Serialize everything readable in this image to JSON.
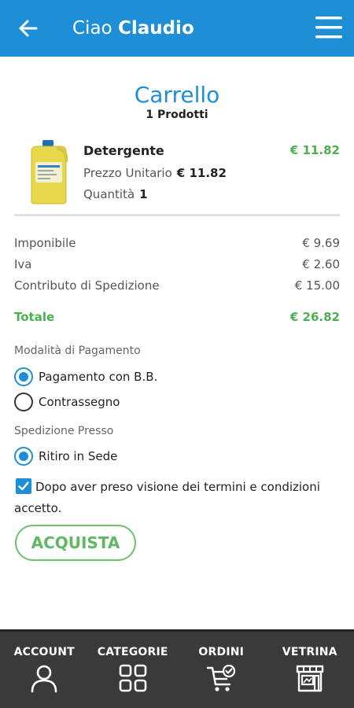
{
  "header": {
    "greeting": "Ciao",
    "user": "Claudio",
    "back_icon": "arrow-left-icon",
    "menu_icon": "hamburger-menu-icon",
    "color": "#1e8fd6"
  },
  "cart": {
    "title": "Carrello",
    "count": "1 Prodotti"
  },
  "product": {
    "name": "Detergente",
    "total": "€ 11.82",
    "unit_label": "Prezzo Unitario",
    "unit_price": "€ 11.82",
    "qty_label": "Quantità",
    "qty": "1"
  },
  "summary": {
    "imponibile_label": "Imponibile",
    "imponibile": "€ 9.69",
    "iva_label": "Iva",
    "iva": "€ 2.60",
    "spedizione_label": "Contributo di Spedizione",
    "spedizione": "€ 15.00",
    "totale_label": "Totale",
    "totale": "€ 26.82",
    "total_color": "#4caf50"
  },
  "payment": {
    "label": "Modalità di Pagamento",
    "options": [
      {
        "label": "Pagamento con B.B.",
        "selected": true
      },
      {
        "label": "Contrassegno",
        "selected": false
      }
    ]
  },
  "shipping": {
    "label": "Spedizione Presso",
    "options": [
      {
        "label": "Ritiro in Sede",
        "selected": true
      }
    ]
  },
  "terms": {
    "text": "Dopo aver preso visione dei termini e condizioni accetto.",
    "checked": true
  },
  "buy_button": "ACQUISTA",
  "nav": [
    {
      "label": "ACCOUNT",
      "icon": "user-icon"
    },
    {
      "label": "CATEGORIE",
      "icon": "grid-icon"
    },
    {
      "label": "ORDINI",
      "icon": "cart-check-icon"
    },
    {
      "label": "VETRINA",
      "icon": "storefront-icon"
    }
  ]
}
